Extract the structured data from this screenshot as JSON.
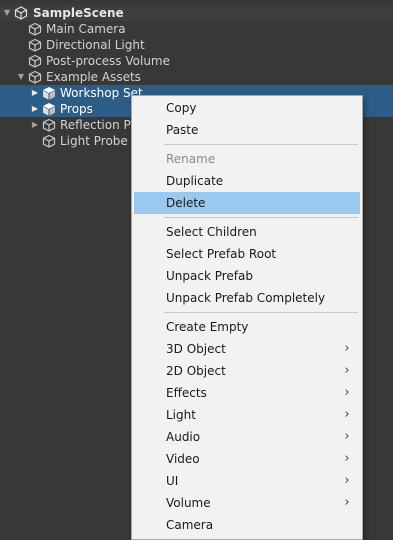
{
  "scene": {
    "name": "SampleScene"
  },
  "hierarchy": {
    "items": [
      {
        "label": "Main Camera"
      },
      {
        "label": "Directional Light"
      },
      {
        "label": "Post-process Volume"
      },
      {
        "label": "Example Assets"
      },
      {
        "label": "Workshop Set"
      },
      {
        "label": "Props"
      },
      {
        "label": "Reflection Pr"
      },
      {
        "label": "Light Probe G"
      }
    ]
  },
  "context_menu": {
    "copy": "Copy",
    "paste": "Paste",
    "rename": "Rename",
    "duplicate": "Duplicate",
    "delete": "Delete",
    "select_children": "Select Children",
    "select_prefab_root": "Select Prefab Root",
    "unpack_prefab": "Unpack Prefab",
    "unpack_prefab_completely": "Unpack Prefab Completely",
    "create_empty": "Create Empty",
    "object_3d": "3D Object",
    "object_2d": "2D Object",
    "effects": "Effects",
    "light": "Light",
    "audio": "Audio",
    "video": "Video",
    "ui": "UI",
    "volume": "Volume",
    "camera": "Camera",
    "submenu_arrow": "›"
  },
  "colors": {
    "background": "#383838",
    "selection": "#2c5d87",
    "menu_background": "#f2f2f2",
    "menu_hover": "#99c9ef",
    "disabled_text": "#8a8a8a"
  },
  "icons": {
    "scene": "unity-scene-icon",
    "gameobject": "gameobject-cube-icon",
    "prefab": "prefab-cube-icon",
    "foldout_open": "▼",
    "foldout_closed": "▶"
  }
}
